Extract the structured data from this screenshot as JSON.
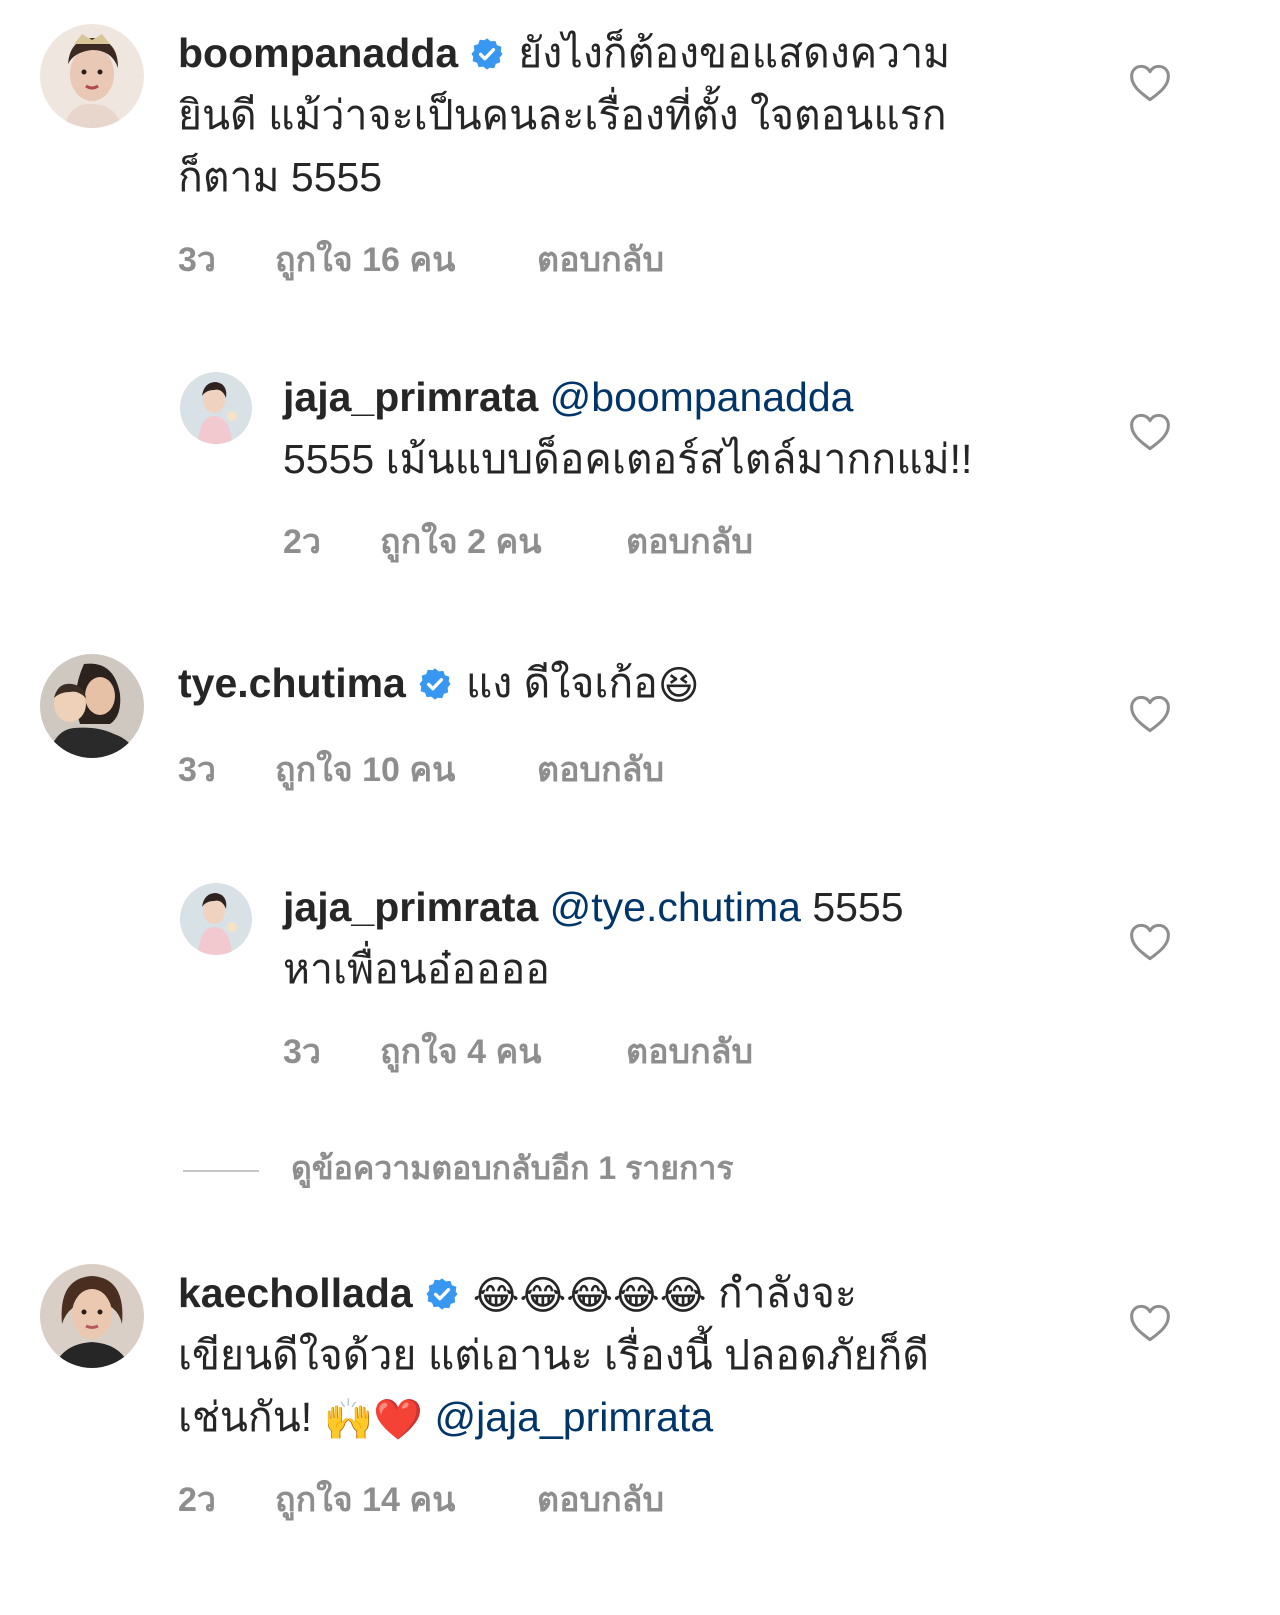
{
  "colors": {
    "text": "#262626",
    "muted": "#8e8e8e",
    "mention": "#003569",
    "verified": "#3897f0"
  },
  "comments": [
    {
      "username": "boompanadda",
      "verified": true,
      "text": "ยังไงก็ต้องขอแสดงความยินดี แม้ว่าจะเป็นคนละเรื่องที่ตั้งใจตอนแรกก็ตาม 5555",
      "lines": [
        "ยังไงก็ต้องขอแสดงความ",
        "ยินดี แม้ว่าจะเป็นคนละเรื่องที่ตั้ง ใจตอนแรก",
        "ก็ตาม 5555"
      ],
      "time": "3ว",
      "likes": "ถูกใจ 16 คน",
      "reply": "ตอบกลับ"
    },
    {
      "username": "jaja_primrata",
      "verified": false,
      "mention": "@boompanadda",
      "lines": [
        "5555 เม้นแบบด็อคเตอร์สไตล์มากกแม่!!"
      ],
      "time": "2ว",
      "likes": "ถูกใจ 2 คน",
      "reply": "ตอบกลับ"
    },
    {
      "username": "tye.chutima",
      "verified": true,
      "text": "แง ดีใจเก้อ",
      "emoji": "😆",
      "time": "3ว",
      "likes": "ถูกใจ 10 คน",
      "reply": "ตอบกลับ"
    },
    {
      "username": "jaja_primrata",
      "verified": false,
      "mention": "@tye.chutima",
      "text_after_mention": " 5555",
      "lines": [
        "หาเพื่อนอ๋ออออ"
      ],
      "time": "3ว",
      "likes": "ถูกใจ 4 คน",
      "reply": "ตอบกลับ"
    },
    {
      "username": "kaechollada",
      "verified": true,
      "emoji_prefix": "😂😂😂😂😂",
      "line1_text": " กำลังจะ",
      "line2": "เขียนดีใจด้วย แต่เอานะ เรื่องนี้ ปลอดภัยก็ดี",
      "line3_text": "เช่นกัน! ",
      "line3_emoji": "🙌❤️",
      "mention": " @jaja_primrata",
      "time": "2ว",
      "likes": "ถูกใจ 14 คน",
      "reply": "ตอบกลับ"
    }
  ],
  "view_more_replies": "ดูข้อความตอบกลับอีก 1 รายการ"
}
